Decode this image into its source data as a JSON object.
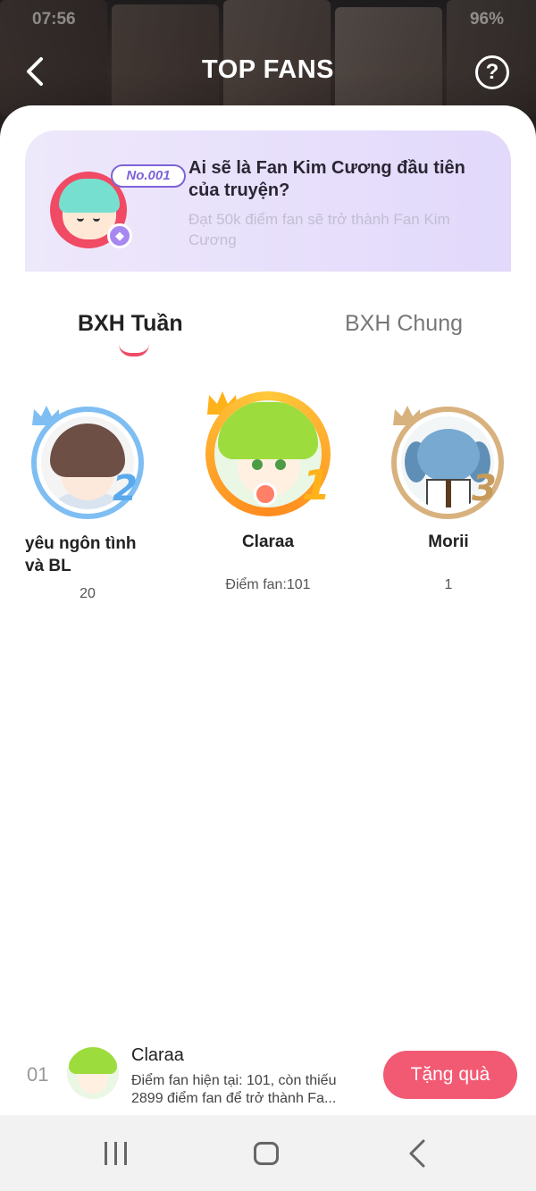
{
  "status_bar": {
    "time": "07:56",
    "battery": "96%"
  },
  "header": {
    "title": "TOP FANS",
    "help_label": "?"
  },
  "promo": {
    "badge": "No.001",
    "title": "Ai sẽ là Fan Kim Cương đầu tiên của truyện?",
    "subtitle": "Đạt 50k điểm fan sẽ trở thành Fan Kim Cương"
  },
  "tabs": [
    {
      "label": "BXH Tuần",
      "active": true
    },
    {
      "label": "BXH Chung",
      "active": false
    }
  ],
  "ranking": [
    {
      "rank": "2",
      "name": "yêu ngôn tình và BL",
      "score": "20",
      "ring_color": "#7fbef2"
    },
    {
      "rank": "1",
      "name": "Claraa",
      "score": "Điểm fan:101",
      "ring_color": "#ffb21a"
    },
    {
      "rank": "3",
      "name": "Morii",
      "score": "1",
      "ring_color": "#d8b27e"
    }
  ],
  "me": {
    "rank": "01",
    "name": "Claraa",
    "description": "Điểm fan hiện tại: 101, còn thiếu 2899 điểm fan để trở thành Fa...",
    "gift_button": "Tặng quà"
  },
  "colors": {
    "accent": "#f25a74",
    "promo_badge": "#7d63d8"
  }
}
